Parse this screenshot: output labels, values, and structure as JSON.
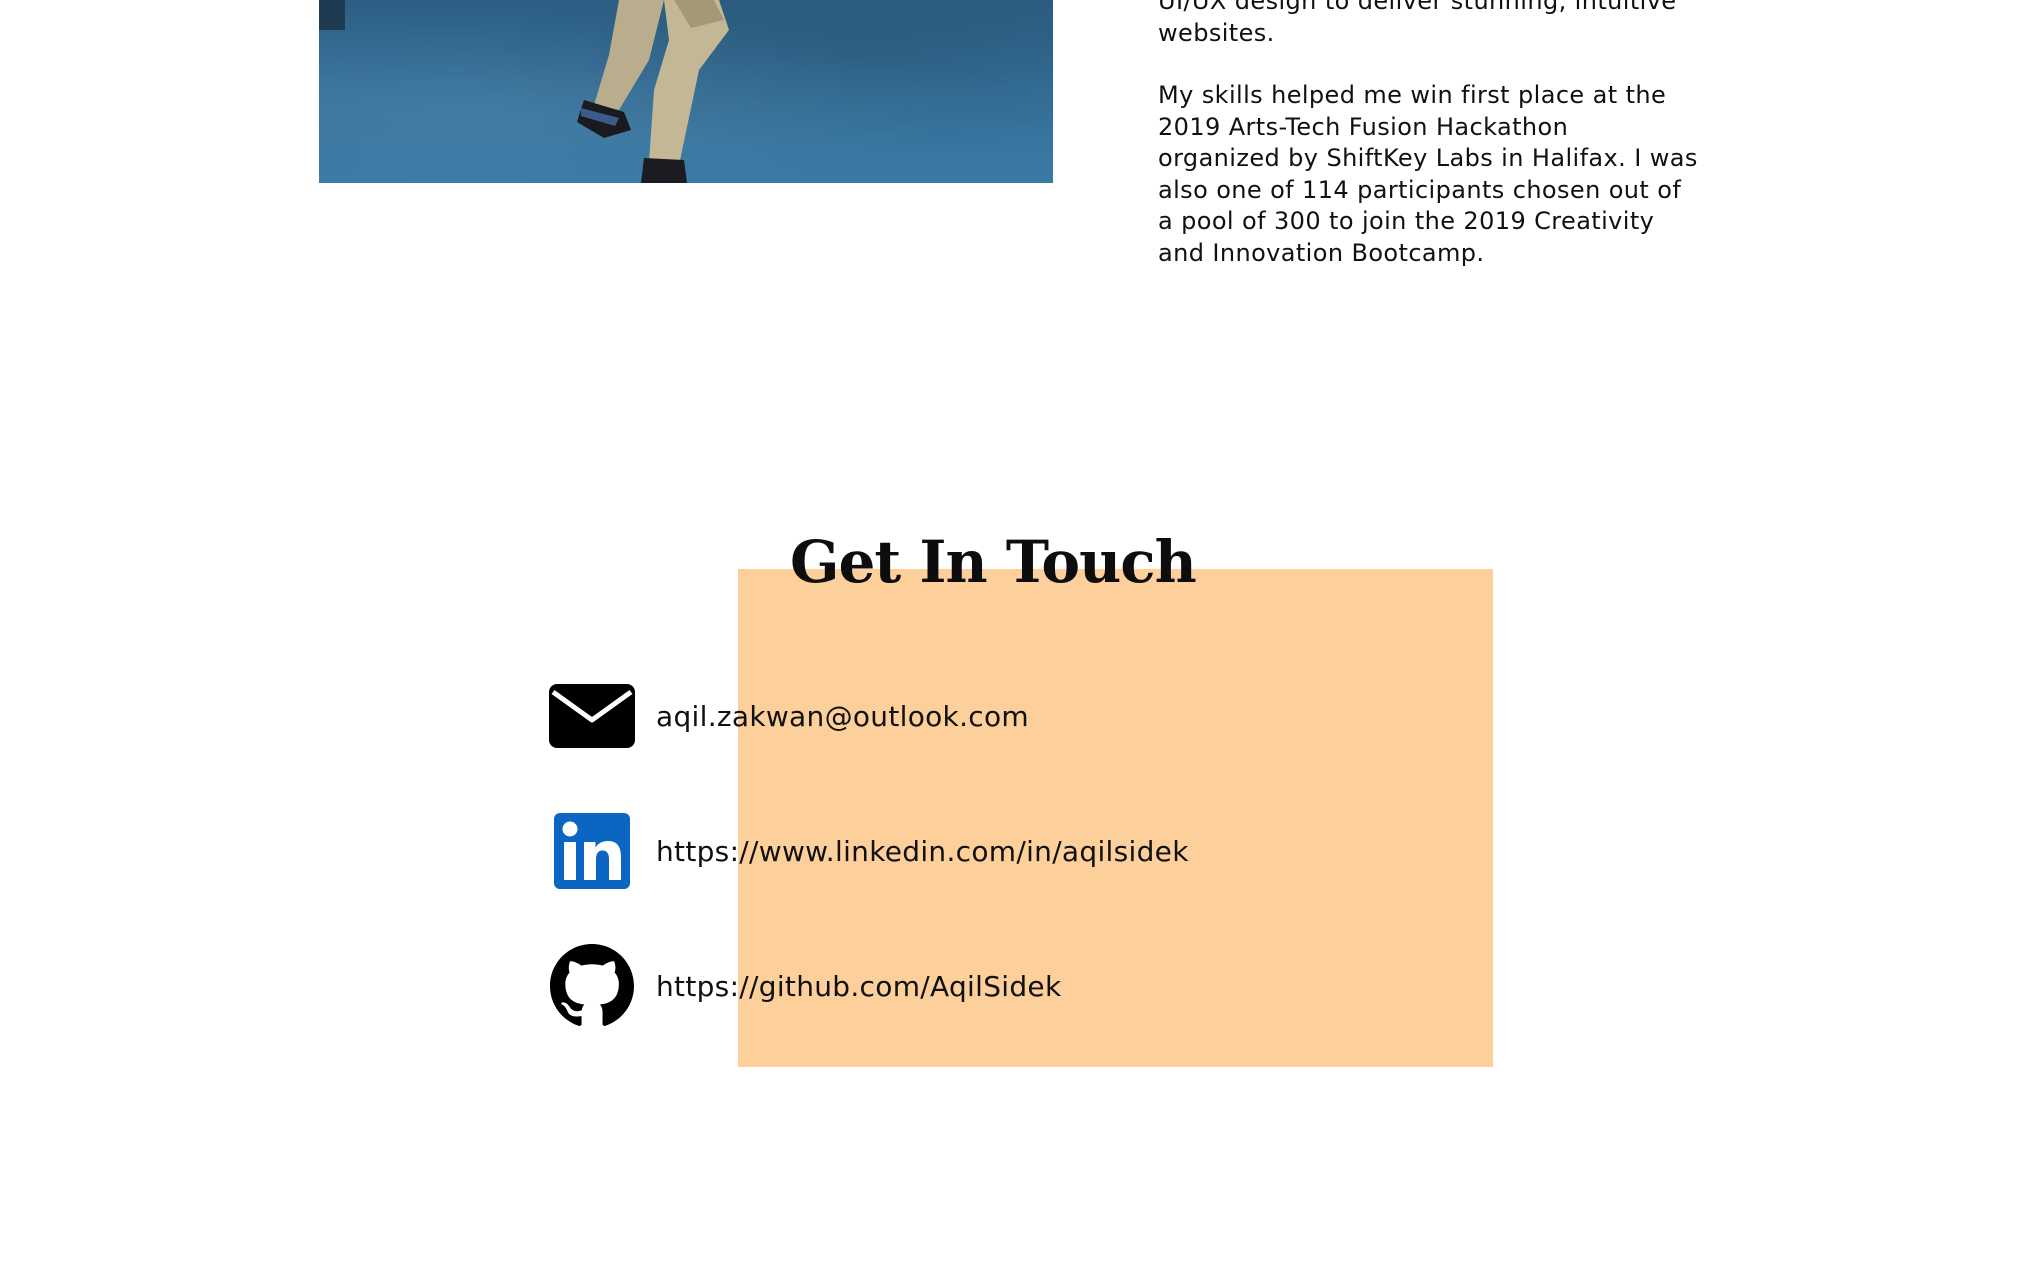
{
  "about": {
    "paragraph_1_tail": "UI/UX design to deliver stunning, intuitive websites.",
    "paragraph_2": "My skills helped me win first place at the 2019 Arts-Tech Fusion Hackathon organized by ShiftKey Labs in Halifax. I was also one of 114 participants chosen out of a pool of 300 to join the 2019 Creativity and Innovation Bootcamp."
  },
  "contact": {
    "title": "Get In Touch",
    "email": "aqil.zakwan@outlook.com",
    "linkedin": "https://www.linkedin.com/in/aqilsidek",
    "github": "https://github.com/AqilSidek"
  },
  "icons": {
    "email": "envelope-icon",
    "linkedin": "linkedin-icon",
    "github": "github-icon"
  },
  "colors": {
    "accent_box": "#fdcf9b",
    "linkedin_blue": "#0a66c2",
    "text": "#111111"
  }
}
